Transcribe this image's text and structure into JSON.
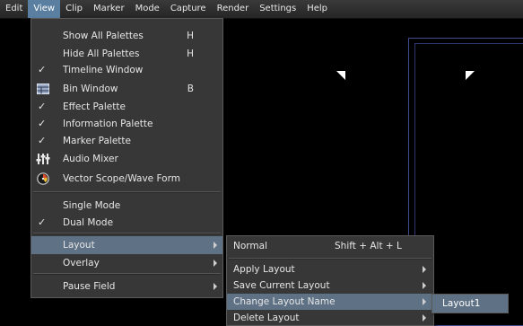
{
  "menubar": {
    "items": [
      "Edit",
      "View",
      "Clip",
      "Marker",
      "Mode",
      "Capture",
      "Render",
      "Settings",
      "Help"
    ],
    "active_index": 1
  },
  "view_menu": {
    "items": [
      {
        "label": "Show All Palettes",
        "accel": "H",
        "mark": ""
      },
      {
        "label": "Hide All Palettes",
        "accel": "H",
        "mark": ""
      },
      {
        "label": "Timeline Window",
        "accel": "",
        "mark": "✓"
      },
      {
        "label": "Bin Window",
        "accel": "B",
        "mark": "",
        "icon": "bin-window-icon"
      },
      {
        "label": "Effect Palette",
        "accel": "",
        "mark": "✓"
      },
      {
        "label": "Information  Palette",
        "accel": "",
        "mark": "✓"
      },
      {
        "label": "Marker Palette",
        "accel": "",
        "mark": "✓"
      },
      {
        "label": "Audio Mixer",
        "accel": "",
        "mark": "",
        "icon": "audio-mixer-icon"
      },
      {
        "label": "Vector Scope/Wave Form",
        "accel": "",
        "mark": "",
        "icon": "vector-scope-icon"
      },
      {
        "label": "Single Mode",
        "accel": "",
        "mark": ""
      },
      {
        "label": "Dual Mode",
        "accel": "",
        "mark": "✓"
      },
      {
        "label": "Layout",
        "accel": "",
        "mark": "",
        "submenu": true,
        "selected": true
      },
      {
        "label": "Overlay",
        "accel": "",
        "mark": "",
        "submenu": true
      },
      {
        "label": "Pause Field",
        "accel": "",
        "mark": "",
        "submenu": true
      }
    ]
  },
  "layout_menu": {
    "items": [
      {
        "label": "Normal",
        "accel": "Shift + Alt + L",
        "submenu": false
      },
      {
        "label": "Apply Layout",
        "accel": "",
        "submenu": true
      },
      {
        "label": "Save Current Layout",
        "accel": "",
        "submenu": true
      },
      {
        "label": "Change Layout Name",
        "accel": "",
        "submenu": true,
        "selected": true
      },
      {
        "label": "Delete Layout",
        "accel": "",
        "submenu": true
      }
    ]
  },
  "change_name_menu": {
    "items": [
      {
        "label": "Layout1"
      }
    ]
  },
  "colors": {
    "menu_bg": "#373737",
    "highlight": "#5e7185",
    "menubar_active": "#5a7fa0",
    "monitor_border": "#3f4b8a"
  }
}
